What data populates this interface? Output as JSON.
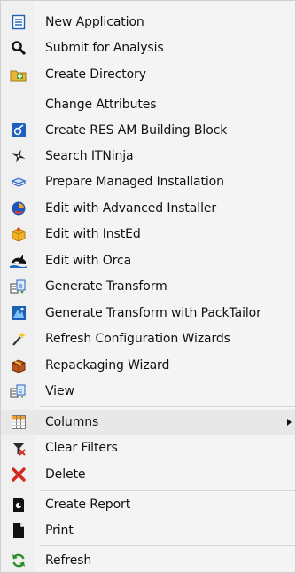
{
  "menu": {
    "items": [
      {
        "label": "New Application",
        "icon": "document-list-icon"
      },
      {
        "label": "Submit for Analysis",
        "icon": "magnifier-icon"
      },
      {
        "label": "Create Directory",
        "icon": "new-folder-icon"
      },
      {
        "label": "Change Attributes",
        "icon": ""
      },
      {
        "label": "Create RES AM Building Block",
        "icon": "res-am-icon"
      },
      {
        "label": "Search ITNinja",
        "icon": "ninja-star-icon"
      },
      {
        "label": "Prepare Managed Installation",
        "icon": "shield-box-icon"
      },
      {
        "label": "Edit with Advanced Installer",
        "icon": "advanced-installer-icon"
      },
      {
        "label": "Edit with InstEd",
        "icon": "insted-box-icon"
      },
      {
        "label": "Edit with Orca",
        "icon": "orca-icon"
      },
      {
        "label": "Generate Transform",
        "icon": "transform-icon"
      },
      {
        "label": "Generate Transform with PackTailor",
        "icon": "packtailor-icon"
      },
      {
        "label": "Refresh Configuration Wizards",
        "icon": "magic-wand-icon"
      },
      {
        "label": "Repackaging Wizard",
        "icon": "package-box-icon"
      },
      {
        "label": "View",
        "icon": "view-transform-icon"
      },
      {
        "label": "Columns",
        "icon": "columns-grid-icon"
      },
      {
        "label": "Clear Filters",
        "icon": "clear-filter-icon"
      },
      {
        "label": "Delete",
        "icon": "delete-x-icon"
      },
      {
        "label": "Create Report",
        "icon": "report-icon"
      },
      {
        "label": "Print",
        "icon": "print-page-icon"
      },
      {
        "label": "Refresh",
        "icon": "refresh-arrows-icon"
      }
    ]
  },
  "colors": {
    "accent_blue": "#1c5fb6",
    "delete_red": "#d22a1e",
    "refresh_green": "#2b8c2b",
    "hover_bg": "#e8e8e8"
  }
}
